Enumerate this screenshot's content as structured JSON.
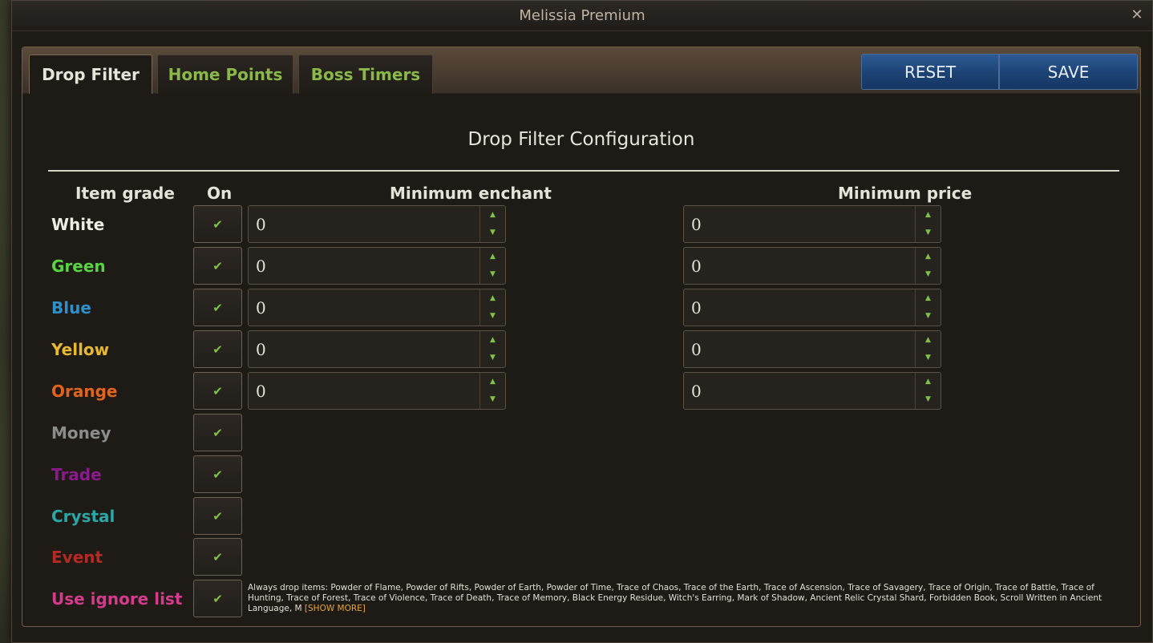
{
  "window": {
    "title": "Melissia Premium"
  },
  "tabs": [
    {
      "label": "Drop Filter",
      "active": true
    },
    {
      "label": "Home Points",
      "active": false
    },
    {
      "label": "Boss Timers",
      "active": false
    }
  ],
  "buttons": {
    "reset": "RESET",
    "save": "SAVE"
  },
  "config": {
    "title": "Drop Filter Configuration",
    "headers": {
      "grade": "Item grade",
      "on": "On",
      "enchant": "Minimum enchant",
      "price": "Minimum price"
    },
    "rows": [
      {
        "grade": "White",
        "color": "#f0ece4",
        "on": true,
        "enchant": "0",
        "price": "0"
      },
      {
        "grade": "Green",
        "color": "#57d43f",
        "on": true,
        "enchant": "0",
        "price": "0"
      },
      {
        "grade": "Blue",
        "color": "#2e8fc9",
        "on": true,
        "enchant": "0",
        "price": "0"
      },
      {
        "grade": "Yellow",
        "color": "#e8b830",
        "on": true,
        "enchant": "0",
        "price": "0"
      },
      {
        "grade": "Orange",
        "color": "#e0641e",
        "on": true,
        "enchant": "0",
        "price": "0"
      },
      {
        "grade": "Money",
        "color": "#8c8c8c",
        "on": true
      },
      {
        "grade": "Trade",
        "color": "#8a1b8a",
        "on": true
      },
      {
        "grade": "Crystal",
        "color": "#2aa7a7",
        "on": true
      },
      {
        "grade": "Event",
        "color": "#b52a22",
        "on": true
      },
      {
        "grade": "Use ignore list",
        "color": "#d63a8c",
        "on": true
      }
    ],
    "check_icon": "checkmark-icon",
    "ignore_list_text": "Always drop items: Powder of Flame, Powder of Rifts, Powder of Earth, Powder of Time, Trace of Chaos, Trace of the Earth, Trace of Ascension, Trace of Savagery, Trace of Origin, Trace of Battle, Trace of Hunting, Trace of Forest, Trace of Violence, Trace of Death, Trace of Memory, Black Energy Residue, Witch's Earring, Mark of Shadow, Ancient Relic Crystal Shard, Forbidden Book, Scroll Written in Ancient Language, M",
    "show_more": "[SHOW MORE]"
  }
}
